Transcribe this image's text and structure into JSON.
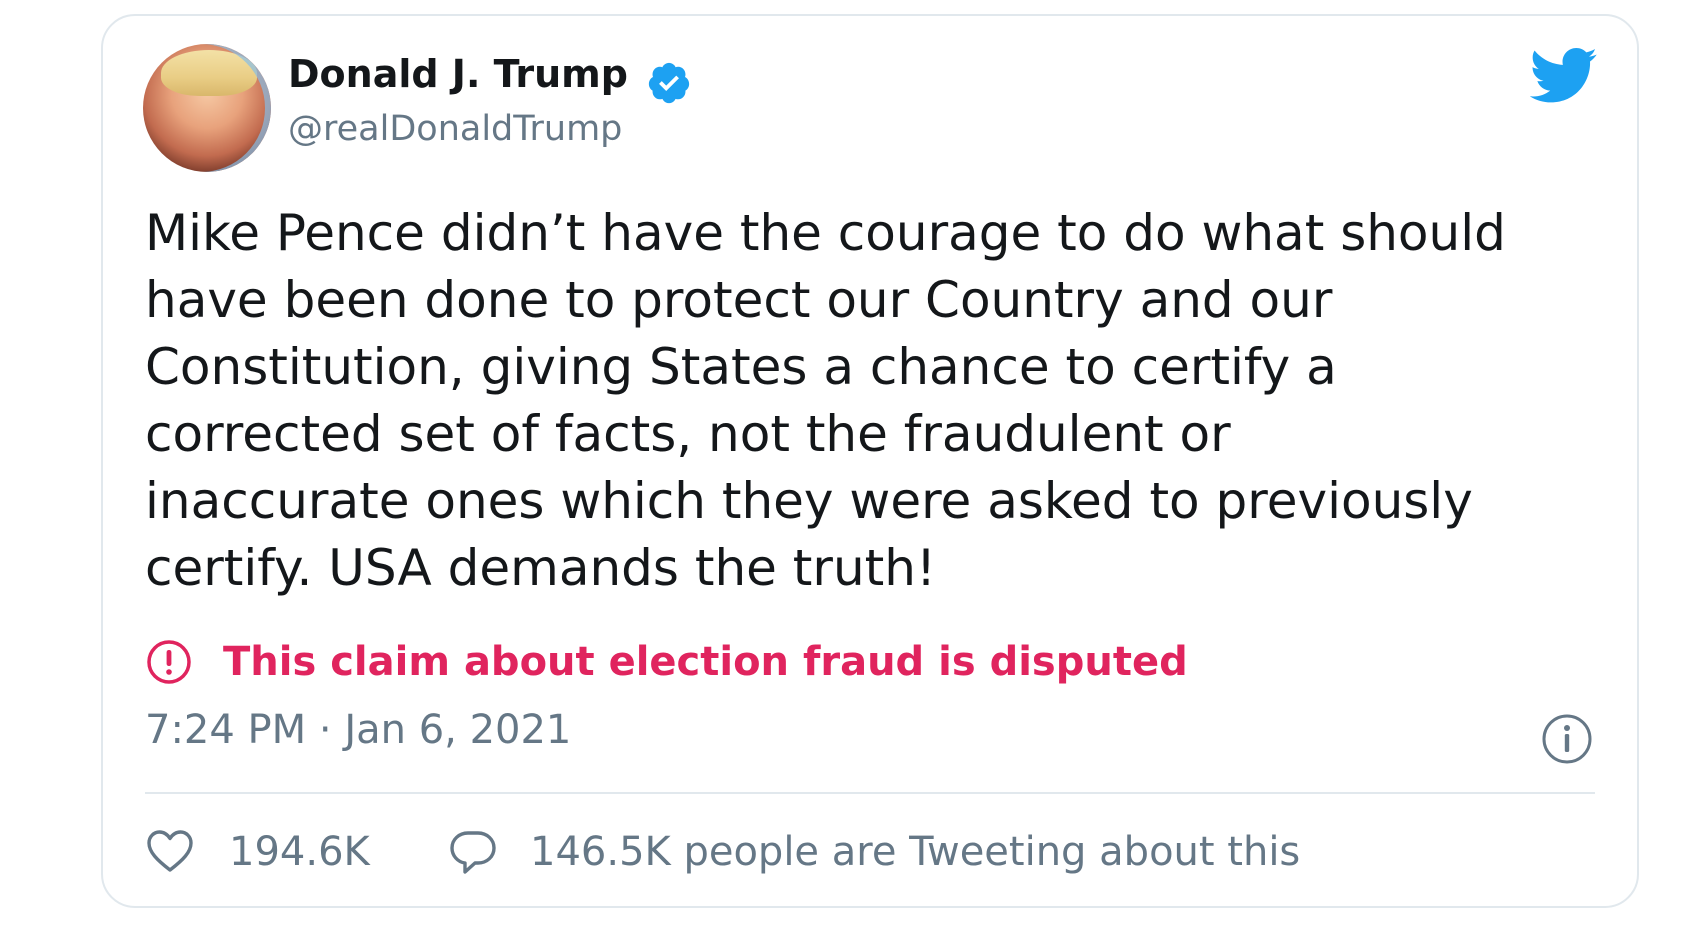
{
  "author": {
    "display_name": "Donald J. Trump",
    "handle": "@realDonaldTrump",
    "verified": true
  },
  "tweet": {
    "text_lines": [
      "Mike Pence didn’t have the courage to do what should",
      "have been done to protect our Country and our",
      "Constitution, giving States a chance to certify a",
      "corrected set of facts, not the fraudulent or",
      "inaccurate ones which they were asked to previously",
      "certify. USA demands the truth!"
    ]
  },
  "label": {
    "text": "This claim about election fraud is disputed",
    "color": "#e0245e"
  },
  "meta": {
    "timestamp": "7:24 PM · Jan 6, 2021"
  },
  "engagement": {
    "likes": "194.6K",
    "conversation": "146.5K people are Tweeting about this"
  },
  "icons": {
    "brand": "twitter-bird-icon",
    "verified": "verified-badge-icon",
    "disputed": "exclamation-circle-icon",
    "info": "info-icon",
    "like": "heart-icon",
    "reply": "speech-bubble-icon"
  },
  "colors": {
    "brand_blue": "#1da1f2",
    "text_primary": "#14171a",
    "text_secondary": "#657786",
    "disputed_red": "#e0245e",
    "border": "#e1e8ed"
  }
}
